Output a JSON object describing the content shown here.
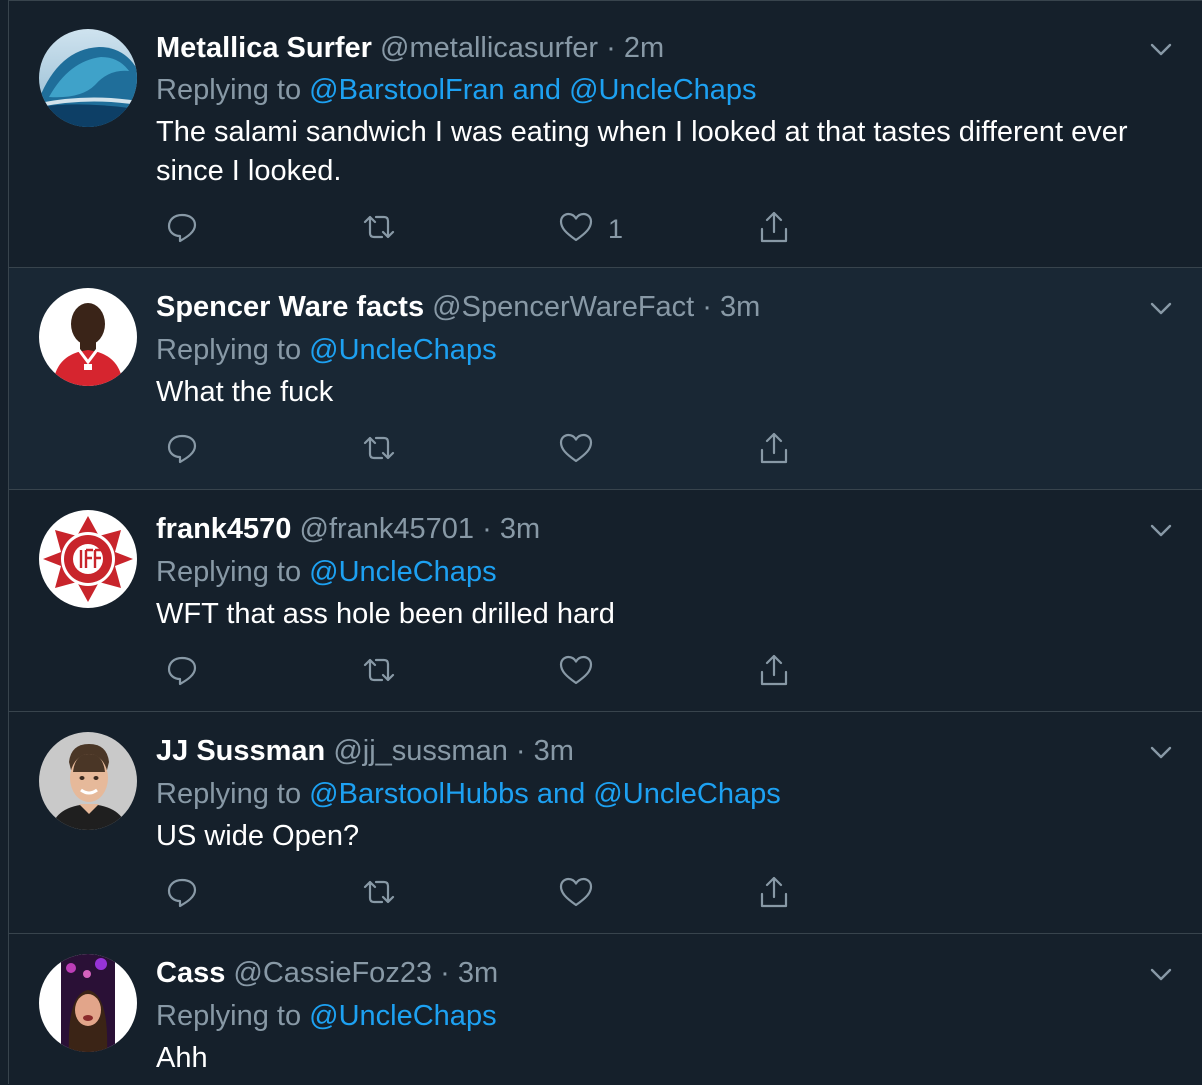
{
  "tweets": [
    {
      "name": "Metallica Surfer",
      "handle": "@metallicasurfer",
      "dot": "·",
      "time": "2m",
      "replying_prefix": "Replying to",
      "replying_to": "@BarstoolFran and @UncleChaps",
      "text": "The salami sandwich I was eating when I looked at that tastes different ever since I looked.",
      "like_count": "1",
      "avatar": "wave-photo"
    },
    {
      "name": "Spencer Ware facts",
      "handle": "@SpencerWareFact",
      "dot": "·",
      "time": "3m",
      "replying_prefix": "Replying to",
      "replying_to": "@UncleChaps",
      "text": "What the fuck",
      "like_count": "",
      "avatar": "football-player-photo"
    },
    {
      "name": "frank4570",
      "handle": "@frank45701",
      "dot": "·",
      "time": "3m",
      "replying_prefix": "Replying to",
      "replying_to": "@UncleChaps",
      "text": "WFT that ass hole been drilled hard",
      "like_count": "",
      "avatar": "iaff-logo"
    },
    {
      "name": "JJ Sussman",
      "handle": "@jj_sussman",
      "dot": "·",
      "time": "3m",
      "replying_prefix": "Replying to",
      "replying_to": "@BarstoolHubbs and @UncleChaps",
      "text": "US wide Open?",
      "like_count": "",
      "avatar": "portrait-photo"
    },
    {
      "name": "Cass",
      "handle": "@CassieFoz23",
      "dot": "·",
      "time": "3m",
      "replying_prefix": "Replying to",
      "replying_to": "@UncleChaps",
      "text": "Ahh",
      "like_count": "",
      "avatar": "concert-selfie-photo"
    }
  ],
  "icons": {
    "reply": "reply-icon",
    "retweet": "retweet-icon",
    "like": "like-icon",
    "share": "share-icon",
    "menu": "chevron-down-icon"
  },
  "colors": {
    "background": "#15202b",
    "hover_background": "#192734",
    "divider": "#38444d",
    "secondary_text": "#8899a6",
    "accent": "#1da1f2"
  }
}
